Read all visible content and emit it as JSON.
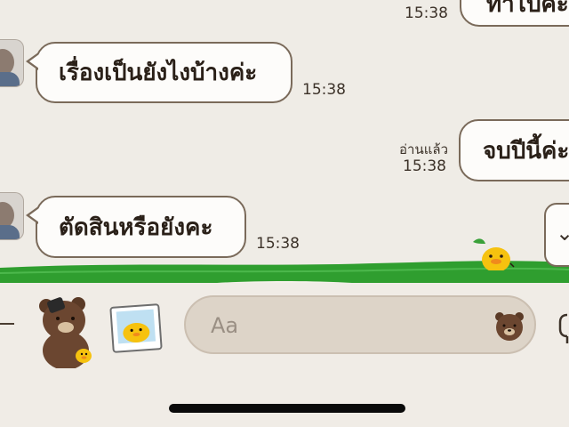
{
  "messages": [
    {
      "direction": "out",
      "text": "ทำไปค่ะ",
      "time": "15:38"
    },
    {
      "direction": "in",
      "text": "เรื่องเป็นยังไงบ้างค่ะ",
      "time": "15:38"
    },
    {
      "direction": "out",
      "text": "จบปีนี้ค่ะ",
      "read_label": "อ่านแล้ว",
      "time": "15:38"
    },
    {
      "direction": "in",
      "text": "ตัดสินหรือยังคะ",
      "time": "15:38"
    }
  ],
  "input": {
    "placeholder": "Aa",
    "value": ""
  },
  "icons": {
    "scroll_down": "chevron-down-icon",
    "emoji": "bear-emoji-icon",
    "mic": "microphone-icon",
    "more": "plus-icon"
  },
  "colors": {
    "background": "#efece6",
    "bubble": "#fdfcfa",
    "bubble_border": "#7a6a5a",
    "grass": "#2f9e2f",
    "input": "#ddd4c8"
  }
}
